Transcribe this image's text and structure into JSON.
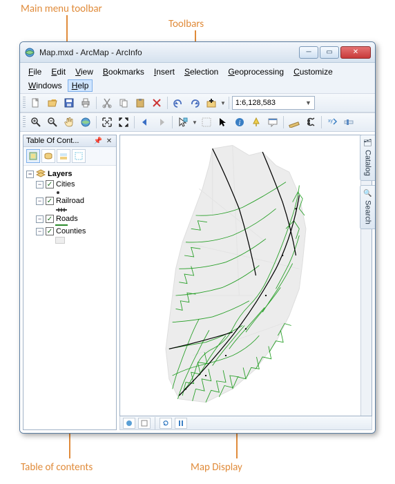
{
  "annotations": {
    "main_menu": "Main menu toolbar",
    "toolbars": "Toolbars",
    "toc": "Table of contents",
    "map_display": "Map Display"
  },
  "window": {
    "title": "Map.mxd - ArcMap - ArcInfo"
  },
  "menubar": {
    "file": "File",
    "edit": "Edit",
    "view": "View",
    "bookmarks": "Bookmarks",
    "insert": "Insert",
    "selection": "Selection",
    "geoprocessing": "Geoprocessing",
    "customize": "Customize",
    "windows": "Windows",
    "help": "Help"
  },
  "toolbar1": {
    "icons": {
      "new": "new-file-icon",
      "open": "open-folder-icon",
      "save": "save-icon",
      "print": "print-icon",
      "cut": "cut-icon",
      "copy": "copy-icon",
      "paste": "paste-icon",
      "delete": "delete-icon",
      "undo": "undo-icon",
      "redo": "redo-icon",
      "add_data": "add-data-icon"
    },
    "scale_value": "1:6,128,583"
  },
  "toolbar2": {
    "icons": {
      "zoom_in": "zoom-in-icon",
      "zoom_out": "zoom-out-icon",
      "pan": "pan-icon",
      "full_extent": "full-extent-icon",
      "fixed_zoom_in": "fixed-zoom-in-icon",
      "fixed_zoom_out": "fixed-zoom-out-icon",
      "back": "back-extent-icon",
      "forward": "forward-extent-icon",
      "select_features": "select-features-icon",
      "clear_selection": "clear-selection-icon",
      "select_elements": "select-elements-icon",
      "identify": "identify-icon",
      "hyperlink": "hyperlink-icon",
      "html_popup": "html-popup-icon",
      "measure": "measure-icon",
      "find": "find-icon",
      "goto_xy": "goto-xy-icon",
      "time_slider": "time-slider-icon"
    }
  },
  "toc": {
    "title": "Table Of Cont...",
    "layers_label": "Layers",
    "layers": [
      {
        "name": "Cities",
        "symbol": "dot"
      },
      {
        "name": "Railroad",
        "symbol": "cross"
      },
      {
        "name": "Roads",
        "symbol": "green-line"
      },
      {
        "name": "Counties",
        "symbol": "box"
      }
    ]
  },
  "side_tabs": {
    "catalog": "Catalog",
    "search": "Search"
  },
  "statusbar": {
    "view_data": "data-view-icon",
    "view_layout": "layout-view-icon",
    "refresh": "refresh-icon",
    "pause": "pause-icon"
  }
}
